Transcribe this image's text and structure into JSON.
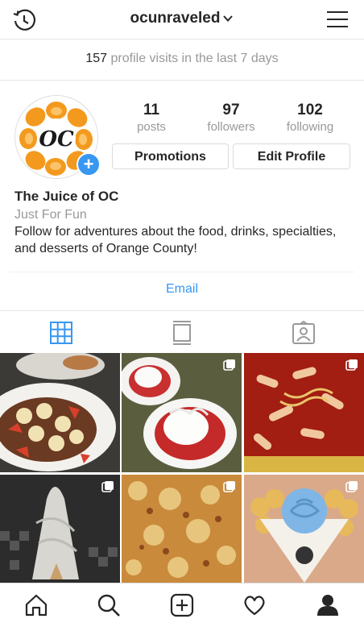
{
  "header": {
    "username": "ocunraveled"
  },
  "visits": {
    "count": "157",
    "text": "profile visits in the last 7 days"
  },
  "profile": {
    "avatar_text": "OC",
    "posts": {
      "value": "11",
      "label": "posts"
    },
    "followers": {
      "value": "97",
      "label": "followers"
    },
    "following": {
      "value": "102",
      "label": "following"
    },
    "promotions_label": "Promotions",
    "edit_label": "Edit Profile",
    "name": "The Juice of OC",
    "category": "Just For Fun",
    "bio": "Follow for adventures about the food, drinks, specialties, and desserts of Orange County!",
    "email_label": "Email"
  },
  "tabs": [
    "grid-icon",
    "feed-icon",
    "tagged-icon"
  ],
  "grid": [
    "french-toast",
    "strawberry-shortcake",
    "tteokbokki",
    "soft-serve-cone",
    "pizza",
    "bubble-waffle-ice-cream"
  ],
  "nav": [
    "home-icon",
    "search-icon",
    "add-icon",
    "heart-icon",
    "profile-icon"
  ],
  "colors": {
    "accent": "#3897f0",
    "muted": "#999999",
    "text": "#262626"
  }
}
